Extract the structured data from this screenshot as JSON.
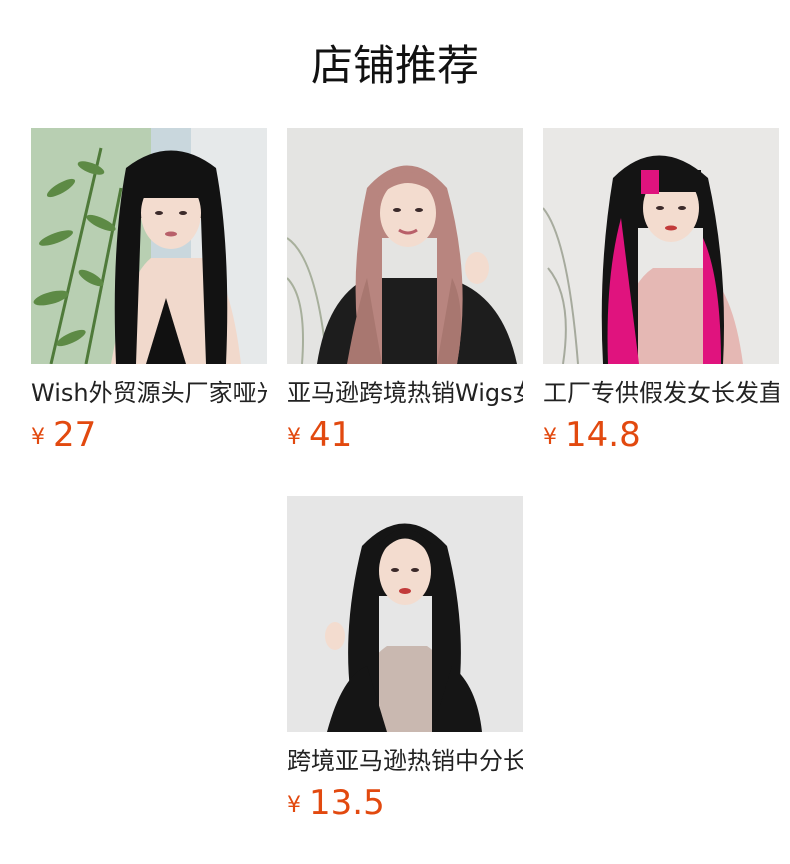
{
  "header": {
    "title": "店铺推荐"
  },
  "colors": {
    "price": "#e2490f",
    "title": "#111111"
  },
  "products": [
    {
      "name": "Wish外贸源头厂家哑光高温丝长卷发",
      "currency": "¥",
      "price": "27",
      "image": "model-long-black-hair-with-bangs"
    },
    {
      "name": "亚马逊跨境热销Wigs女士长卷发",
      "currency": "¥",
      "price": "41",
      "image": "model-pink-wavy-hair"
    },
    {
      "name": "工厂专供假发女长发直发挑染",
      "currency": "¥",
      "price": "14.8",
      "image": "model-black-pink-highlight-hair"
    },
    {
      "name": "跨境亚马逊热销中分长卷发假发",
      "currency": "¥",
      "price": "13.5",
      "image": "model-black-wavy-center-part"
    }
  ]
}
